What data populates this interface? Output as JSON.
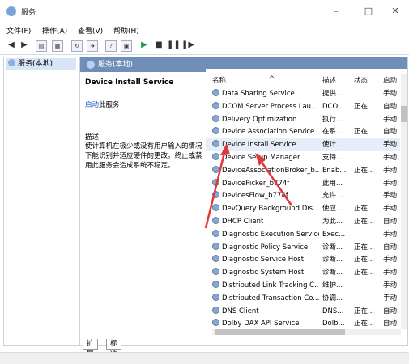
{
  "window": {
    "title": "服务"
  },
  "menu": [
    "文件(F)",
    "操作(A)",
    "查看(V)",
    "帮助(H)"
  ],
  "tree": {
    "node": "服务(本地)"
  },
  "panel": {
    "header": "服务(本地)"
  },
  "details": {
    "service_name": "Device Install Service",
    "start_link": "启动",
    "start_suffix": "此服务",
    "desc_label": "描述:",
    "desc_text": "使计算机在极少或没有用户输入的情况下能识别并适应硬件的更改。终止或禁用此服务会造成系统不稳定。"
  },
  "columns": {
    "name": "名称",
    "desc": "描述",
    "status": "状态",
    "startup": "启动:"
  },
  "services": [
    {
      "name": "Data Sharing Service",
      "desc": "提供...",
      "status": "",
      "startup": "手动"
    },
    {
      "name": "DCOM Server Process Lau...",
      "desc": "DCO...",
      "status": "正在...",
      "startup": "自动"
    },
    {
      "name": "Delivery Optimization",
      "desc": "执行...",
      "status": "",
      "startup": "手动"
    },
    {
      "name": "Device Association Service",
      "desc": "在系...",
      "status": "正在...",
      "startup": "自动"
    },
    {
      "name": "Device Install Service",
      "desc": "使计...",
      "status": "",
      "startup": "手动"
    },
    {
      "name": "Device Setup Manager",
      "desc": "支持...",
      "status": "",
      "startup": "手动"
    },
    {
      "name": "DeviceAssociationBroker_b...",
      "desc": "Enab...",
      "status": "正在...",
      "startup": "手动"
    },
    {
      "name": "DevicePicker_b774f",
      "desc": "此用...",
      "status": "",
      "startup": "手动"
    },
    {
      "name": "DevicesFlow_b774f",
      "desc": "允许 ...",
      "status": "",
      "startup": "手动"
    },
    {
      "name": "DevQuery Background Dis...",
      "desc": "使应...",
      "status": "正在...",
      "startup": "手动"
    },
    {
      "name": "DHCP Client",
      "desc": "为此...",
      "status": "正在...",
      "startup": "自动"
    },
    {
      "name": "Diagnostic Execution Service",
      "desc": "Exec...",
      "status": "",
      "startup": "手动"
    },
    {
      "name": "Diagnostic Policy Service",
      "desc": "诊断...",
      "status": "正在...",
      "startup": "自动"
    },
    {
      "name": "Diagnostic Service Host",
      "desc": "诊断...",
      "status": "正在...",
      "startup": "手动"
    },
    {
      "name": "Diagnostic System Host",
      "desc": "诊断...",
      "status": "正在...",
      "startup": "手动"
    },
    {
      "name": "Distributed Link Tracking C...",
      "desc": "维护...",
      "status": "",
      "startup": "手动"
    },
    {
      "name": "Distributed Transaction Co...",
      "desc": "协调...",
      "status": "",
      "startup": "手动"
    },
    {
      "name": "DNS Client",
      "desc": "DNS...",
      "status": "正在...",
      "startup": "自动"
    },
    {
      "name": "Dolby DAX API Service",
      "desc": "Dolb...",
      "status": "正在...",
      "startup": "自动"
    }
  ],
  "tabs": [
    "扩展",
    "标准"
  ],
  "accent": "#e0383b",
  "header_color": "#6f8fb8"
}
